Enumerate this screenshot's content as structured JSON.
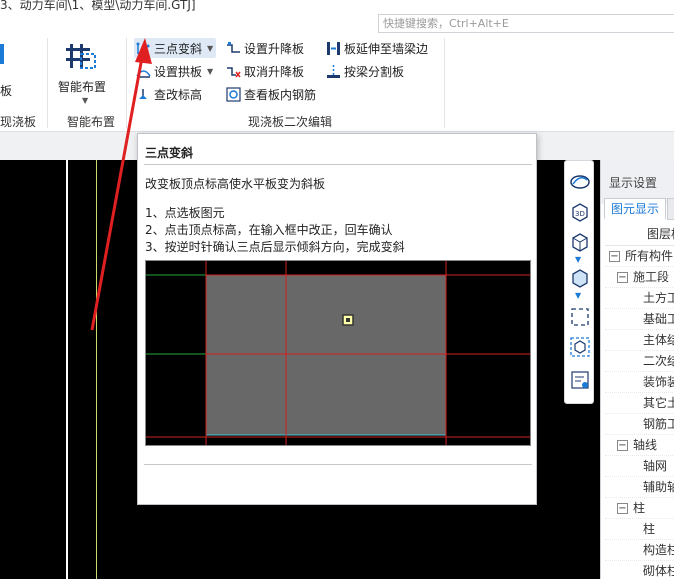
{
  "window": {
    "title": "3、动力车间\\1、模型\\动力车间.GTJ]",
    "search_placeholder": "快捷键搜索，Ctrl+Alt+E"
  },
  "ribbon": {
    "partial_left_label": "板",
    "groups": [
      {
        "label": "现浇板"
      },
      {
        "label": "智能布置"
      },
      {
        "label": "现浇板二次编辑"
      }
    ],
    "smart_layout_btn": "智能布置",
    "buttons": {
      "three_point_slope": "三点变斜",
      "set_rise_fall_slab": "设置升降板",
      "extend_slab_to_wall_beam": "板延伸至墙梁边",
      "set_arch_slab": "设置拱板",
      "cancel_rise_fall_slab": "取消升降板",
      "split_slab_by_beam": "按梁分割板",
      "check_edit_elevation": "查改标高",
      "view_slab_rebar": "查看板内钢筋"
    }
  },
  "tooltip": {
    "title": "三点变斜",
    "description": "改变板顶点标高使水平板变为斜板",
    "steps": [
      "1、点选板图元",
      "2、点击顶点标高，在输入框中改正，回车确认",
      "3、按逆时针确认三点后显示倾斜方向，完成变斜"
    ]
  },
  "display_panel": {
    "title": "显示设置",
    "tab_label": "图元显示",
    "tree_header": "图层构",
    "tree_items": [
      {
        "label": "所有构件",
        "level": 0,
        "box": "−"
      },
      {
        "label": "施工段",
        "level": 1,
        "box": "−"
      },
      {
        "label": "土方工",
        "level": 2
      },
      {
        "label": "基础工",
        "level": 2
      },
      {
        "label": "主体结",
        "level": 2
      },
      {
        "label": "二次结",
        "level": 2
      },
      {
        "label": "装饰装",
        "level": 2
      },
      {
        "label": "其它土",
        "level": 2
      },
      {
        "label": "钢筋工",
        "level": 2
      },
      {
        "label": "轴线",
        "level": 1,
        "box": "−"
      },
      {
        "label": "轴网",
        "level": 2
      },
      {
        "label": "辅助轴",
        "level": 2
      },
      {
        "label": "柱",
        "level": 1,
        "box": "−"
      },
      {
        "label": "柱",
        "level": 2
      },
      {
        "label": "构造柱",
        "level": 2
      },
      {
        "label": "砌体柱",
        "level": 2
      }
    ]
  },
  "colors": {
    "accent_blue": "#1d7bd8",
    "arrow_red": "#e02020",
    "canvas": "#000000"
  }
}
